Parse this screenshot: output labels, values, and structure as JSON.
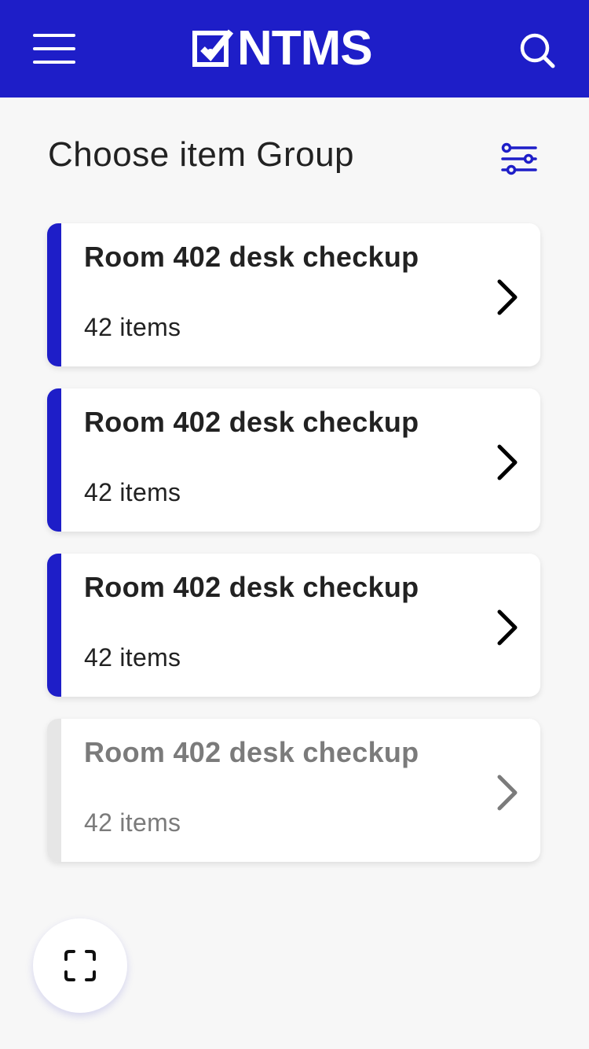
{
  "header": {
    "logo_text": "NTMS",
    "menu_icon": "hamburger-menu-icon",
    "search_icon": "search-icon",
    "background_color": "#1e1ec8"
  },
  "page": {
    "title": "Choose item Group",
    "filter_icon": "sliders-filter-icon"
  },
  "groups": [
    {
      "title": "Room 402 desk checkup",
      "count": "42 items",
      "state": "active"
    },
    {
      "title": "Room 402 desk checkup",
      "count": "42 items",
      "state": "active"
    },
    {
      "title": "Room 402 desk checkup",
      "count": "42 items",
      "state": "active"
    },
    {
      "title": "Room 402 desk checkup",
      "count": "42 items",
      "state": "disabled"
    }
  ],
  "scan_button": {
    "icon": "scan-frame-icon"
  },
  "colors": {
    "accent": "#1e1ec8",
    "text": "#222222",
    "muted_text": "#7b7b7b",
    "background": "#f7f7f7"
  }
}
